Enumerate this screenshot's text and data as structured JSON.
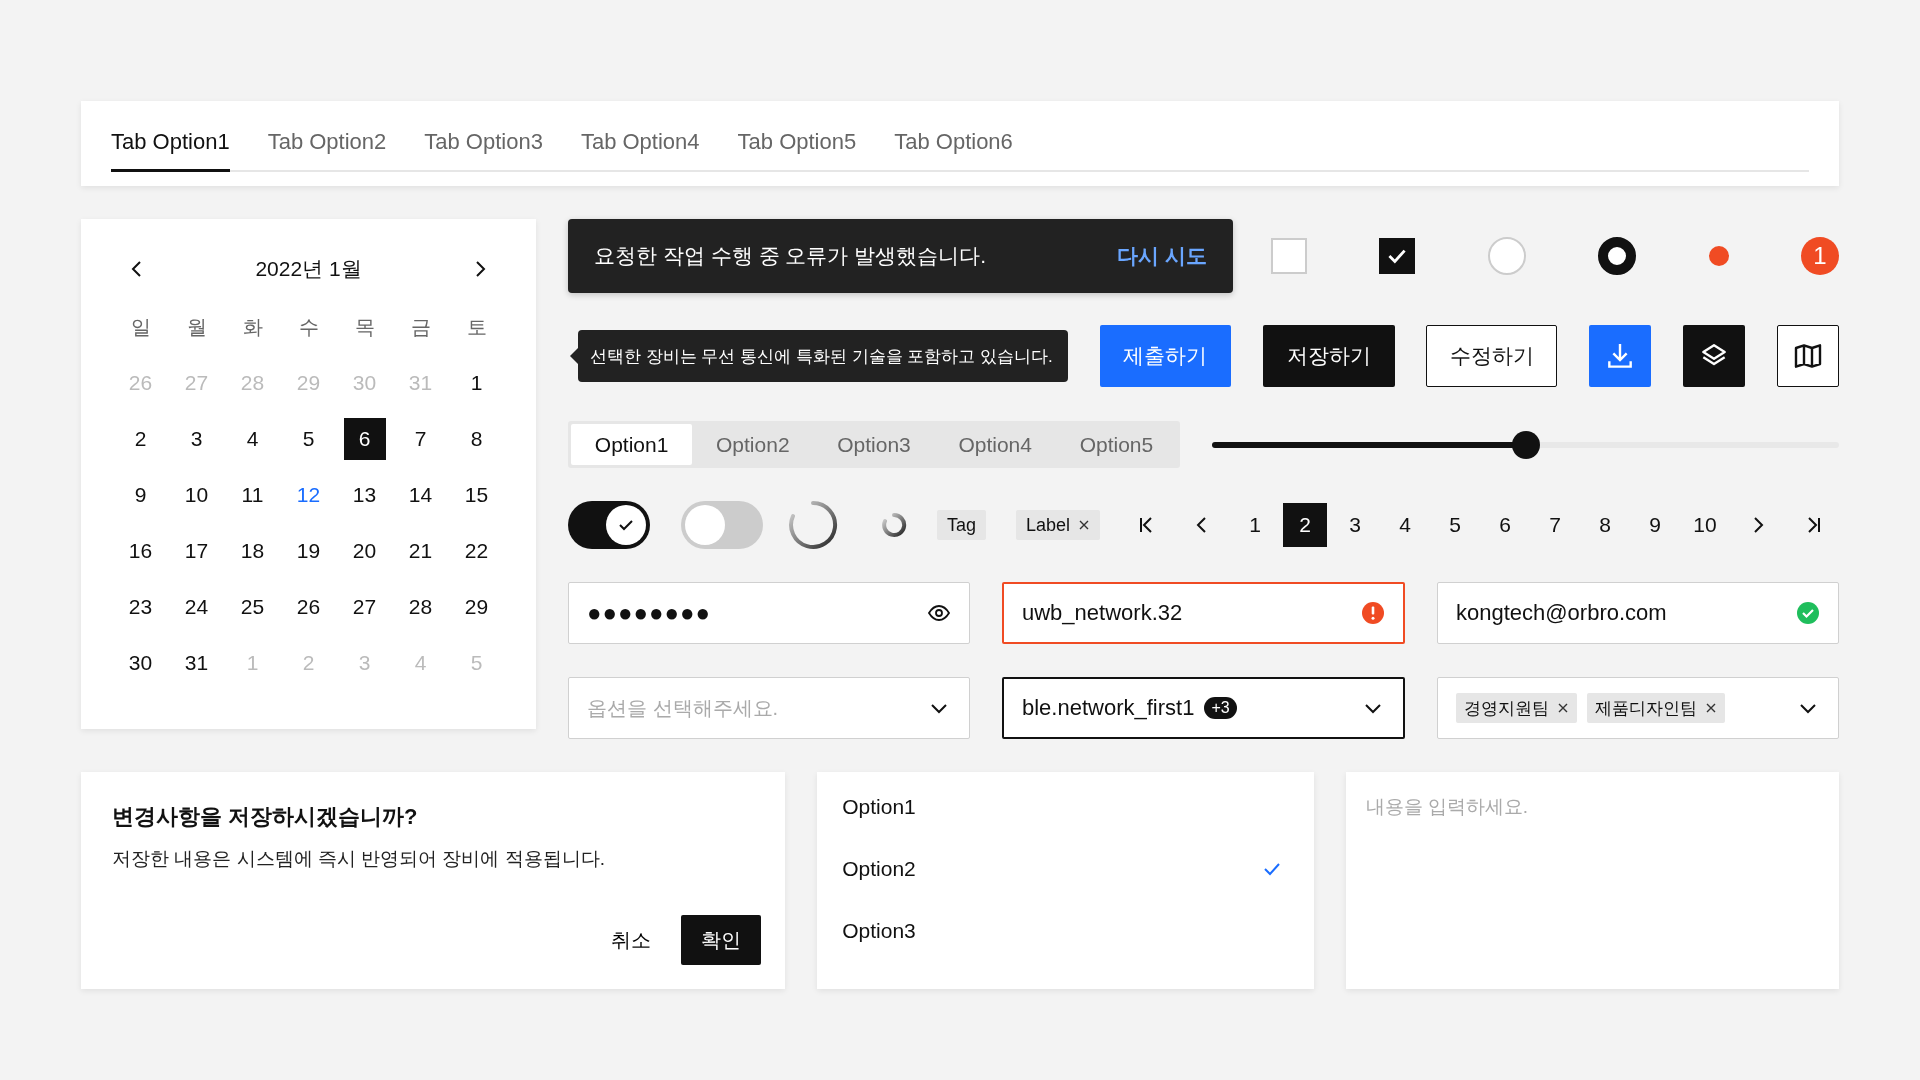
{
  "tabs": [
    {
      "label": "Tab Option1",
      "selected": true
    },
    {
      "label": "Tab Option2",
      "selected": false
    },
    {
      "label": "Tab Option3",
      "selected": false
    },
    {
      "label": "Tab Option4",
      "selected": false
    },
    {
      "label": "Tab Option5",
      "selected": false
    },
    {
      "label": "Tab Option6",
      "selected": false
    }
  ],
  "calendar": {
    "title": "2022년 1월",
    "weekdays": [
      "일",
      "월",
      "화",
      "수",
      "목",
      "금",
      "토"
    ],
    "days": [
      {
        "label": "26",
        "muted": true,
        "selected": false,
        "today": false
      },
      {
        "label": "27",
        "muted": true,
        "selected": false,
        "today": false
      },
      {
        "label": "28",
        "muted": true,
        "selected": false,
        "today": false
      },
      {
        "label": "29",
        "muted": true,
        "selected": false,
        "today": false
      },
      {
        "label": "30",
        "muted": true,
        "selected": false,
        "today": false
      },
      {
        "label": "31",
        "muted": true,
        "selected": false,
        "today": false
      },
      {
        "label": "1",
        "muted": false,
        "selected": false,
        "today": false
      },
      {
        "label": "2",
        "muted": false,
        "selected": false,
        "today": false
      },
      {
        "label": "3",
        "muted": false,
        "selected": false,
        "today": false
      },
      {
        "label": "4",
        "muted": false,
        "selected": false,
        "today": false
      },
      {
        "label": "5",
        "muted": false,
        "selected": false,
        "today": false
      },
      {
        "label": "6",
        "muted": false,
        "selected": true,
        "today": false
      },
      {
        "label": "7",
        "muted": false,
        "selected": false,
        "today": false
      },
      {
        "label": "8",
        "muted": false,
        "selected": false,
        "today": false
      },
      {
        "label": "9",
        "muted": false,
        "selected": false,
        "today": false
      },
      {
        "label": "10",
        "muted": false,
        "selected": false,
        "today": false
      },
      {
        "label": "11",
        "muted": false,
        "selected": false,
        "today": false
      },
      {
        "label": "12",
        "muted": false,
        "selected": false,
        "today": true
      },
      {
        "label": "13",
        "muted": false,
        "selected": false,
        "today": false
      },
      {
        "label": "14",
        "muted": false,
        "selected": false,
        "today": false
      },
      {
        "label": "15",
        "muted": false,
        "selected": false,
        "today": false
      },
      {
        "label": "16",
        "muted": false,
        "selected": false,
        "today": false
      },
      {
        "label": "17",
        "muted": false,
        "selected": false,
        "today": false
      },
      {
        "label": "18",
        "muted": false,
        "selected": false,
        "today": false
      },
      {
        "label": "19",
        "muted": false,
        "selected": false,
        "today": false
      },
      {
        "label": "20",
        "muted": false,
        "selected": false,
        "today": false
      },
      {
        "label": "21",
        "muted": false,
        "selected": false,
        "today": false
      },
      {
        "label": "22",
        "muted": false,
        "selected": false,
        "today": false
      },
      {
        "label": "23",
        "muted": false,
        "selected": false,
        "today": false
      },
      {
        "label": "24",
        "muted": false,
        "selected": false,
        "today": false
      },
      {
        "label": "25",
        "muted": false,
        "selected": false,
        "today": false
      },
      {
        "label": "26",
        "muted": false,
        "selected": false,
        "today": false
      },
      {
        "label": "27",
        "muted": false,
        "selected": false,
        "today": false
      },
      {
        "label": "28",
        "muted": false,
        "selected": false,
        "today": false
      },
      {
        "label": "29",
        "muted": false,
        "selected": false,
        "today": false
      },
      {
        "label": "30",
        "muted": false,
        "selected": false,
        "today": false
      },
      {
        "label": "31",
        "muted": false,
        "selected": false,
        "today": false
      },
      {
        "label": "1",
        "muted": true,
        "selected": false,
        "today": false
      },
      {
        "label": "2",
        "muted": true,
        "selected": false,
        "today": false
      },
      {
        "label": "3",
        "muted": true,
        "selected": false,
        "today": false
      },
      {
        "label": "4",
        "muted": true,
        "selected": false,
        "today": false
      },
      {
        "label": "5",
        "muted": true,
        "selected": false,
        "today": false
      }
    ]
  },
  "toast": {
    "message": "요청한 작업 수행 중 오류가 발생했습니다.",
    "action": "다시 시도"
  },
  "indicators": [
    {
      "kind": "checkbox",
      "checked": false
    },
    {
      "kind": "checkbox",
      "checked": true
    },
    {
      "kind": "radio",
      "selected": false
    },
    {
      "kind": "radio",
      "selected": true
    },
    {
      "kind": "dot",
      "color": "#f04b23"
    },
    {
      "kind": "badge",
      "text": "1"
    }
  ],
  "tooltip": {
    "text": "선택한 장비는 무선 통신에 특화된 기술을 포함하고 있습니다."
  },
  "buttons": [
    {
      "kind": "primary",
      "label": "제출하기"
    },
    {
      "kind": "dark",
      "label": "저장하기"
    },
    {
      "kind": "outline",
      "label": "수정하기"
    },
    {
      "kind": "primary-icon"
    },
    {
      "kind": "dark-icon"
    },
    {
      "kind": "outline-icon"
    }
  ],
  "segments": [
    {
      "label": "Option1",
      "selected": true
    },
    {
      "label": "Option2",
      "selected": false
    },
    {
      "label": "Option3",
      "selected": false
    },
    {
      "label": "Option4",
      "selected": false
    },
    {
      "label": "Option5",
      "selected": false
    }
  ],
  "slider": {
    "level": 0.5
  },
  "toggles": [
    {
      "on": true
    },
    {
      "on": false
    }
  ],
  "chips": [
    {
      "label": "Tag",
      "removable": false
    },
    {
      "label": "Label",
      "removable": true
    }
  ],
  "pagination": [
    {
      "label": "1",
      "selected": false
    },
    {
      "label": "2",
      "selected": true
    },
    {
      "label": "3",
      "selected": false
    },
    {
      "label": "4",
      "selected": false
    },
    {
      "label": "5",
      "selected": false
    },
    {
      "label": "6",
      "selected": false
    },
    {
      "label": "7",
      "selected": false
    },
    {
      "label": "8",
      "selected": false
    },
    {
      "label": "9",
      "selected": false
    },
    {
      "label": "10",
      "selected": false
    }
  ],
  "fields": [
    {
      "kind": "password",
      "value": "●●●●●●●●"
    },
    {
      "kind": "error",
      "value": "uwb_network.32"
    },
    {
      "kind": "success",
      "value": "kongtech@orbro.com"
    }
  ],
  "selects": [
    {
      "kind": "placeholder",
      "placeholder": "옵션을 선택해주세요."
    },
    {
      "kind": "focused",
      "value": "ble.network_first1",
      "count": "+3"
    },
    {
      "kind": "tags",
      "tags": [
        "경영지원팀",
        "제품디자인팀"
      ]
    }
  ],
  "dialog": {
    "title": "변경사항을 저장하시겠습니까?",
    "message": "저장한 내용은 시스템에 즉시 반영되어 장비에 적용됩니다.",
    "cancel": "취소",
    "confirm": "확인"
  },
  "listbox": [
    {
      "label": "Option1",
      "selected": false
    },
    {
      "label": "Option2",
      "selected": true
    },
    {
      "label": "Option3",
      "selected": false
    }
  ],
  "textarea": {
    "placeholder": "내용을 입력하세요."
  }
}
